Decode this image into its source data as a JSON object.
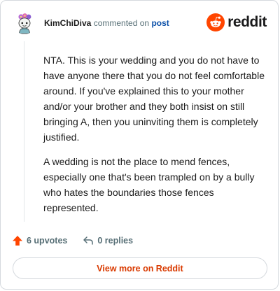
{
  "comment": {
    "username": "KimChiDiva",
    "action_text": "commented on",
    "link_text": "post",
    "paragraphs": [
      "NTA. This is your wedding and you do not have to have anyone there that you do not feel comfortable around. If you've explained this to your mother and/or your brother and they both insist on still bringing A, then you uninviting them is completely justified.",
      "A wedding is not the place to mend fences, especially one that's been trampled on by a bully who hates the boundaries those fences represented."
    ]
  },
  "brand": {
    "wordmark": "reddit",
    "logo_icon": "reddit-snoo-icon"
  },
  "actions": {
    "upvotes_label": "6 upvotes",
    "upvote_icon": "upvote-arrow-icon",
    "replies_label": "0 replies",
    "reply_icon": "reply-arrow-icon"
  },
  "footer": {
    "view_more_label": "View more on Reddit"
  },
  "colors": {
    "brand_orange": "#ff4500",
    "upvote_orange": "#ff4500",
    "link_blue": "#0a4fa8",
    "view_more_text": "#d93a00",
    "muted_text": "#576f76",
    "border": "#d5d9de"
  }
}
